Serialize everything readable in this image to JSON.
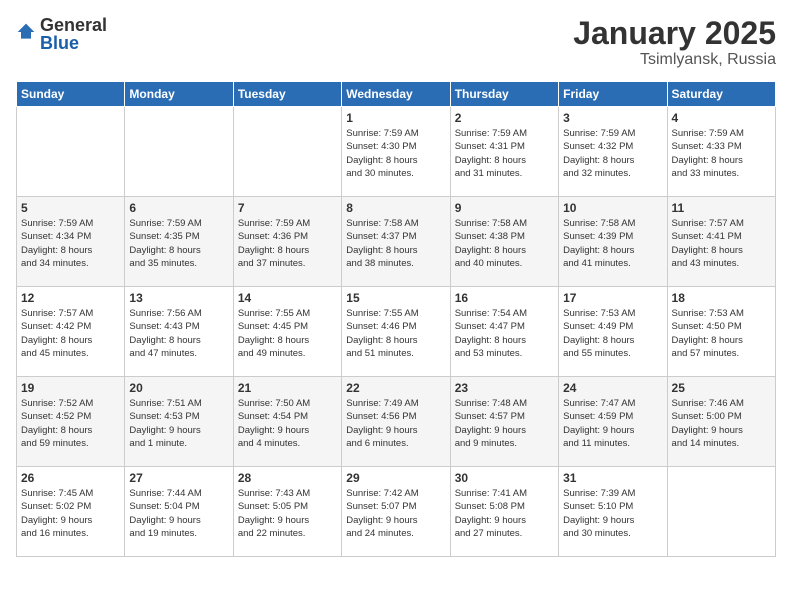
{
  "logo": {
    "text_general": "General",
    "text_blue": "Blue"
  },
  "header": {
    "month": "January 2025",
    "location": "Tsimlyansk, Russia"
  },
  "weekdays": [
    "Sunday",
    "Monday",
    "Tuesday",
    "Wednesday",
    "Thursday",
    "Friday",
    "Saturday"
  ],
  "weeks": [
    [
      {
        "day": "",
        "info": ""
      },
      {
        "day": "",
        "info": ""
      },
      {
        "day": "",
        "info": ""
      },
      {
        "day": "1",
        "info": "Sunrise: 7:59 AM\nSunset: 4:30 PM\nDaylight: 8 hours\nand 30 minutes."
      },
      {
        "day": "2",
        "info": "Sunrise: 7:59 AM\nSunset: 4:31 PM\nDaylight: 8 hours\nand 31 minutes."
      },
      {
        "day": "3",
        "info": "Sunrise: 7:59 AM\nSunset: 4:32 PM\nDaylight: 8 hours\nand 32 minutes."
      },
      {
        "day": "4",
        "info": "Sunrise: 7:59 AM\nSunset: 4:33 PM\nDaylight: 8 hours\nand 33 minutes."
      }
    ],
    [
      {
        "day": "5",
        "info": "Sunrise: 7:59 AM\nSunset: 4:34 PM\nDaylight: 8 hours\nand 34 minutes."
      },
      {
        "day": "6",
        "info": "Sunrise: 7:59 AM\nSunset: 4:35 PM\nDaylight: 8 hours\nand 35 minutes."
      },
      {
        "day": "7",
        "info": "Sunrise: 7:59 AM\nSunset: 4:36 PM\nDaylight: 8 hours\nand 37 minutes."
      },
      {
        "day": "8",
        "info": "Sunrise: 7:58 AM\nSunset: 4:37 PM\nDaylight: 8 hours\nand 38 minutes."
      },
      {
        "day": "9",
        "info": "Sunrise: 7:58 AM\nSunset: 4:38 PM\nDaylight: 8 hours\nand 40 minutes."
      },
      {
        "day": "10",
        "info": "Sunrise: 7:58 AM\nSunset: 4:39 PM\nDaylight: 8 hours\nand 41 minutes."
      },
      {
        "day": "11",
        "info": "Sunrise: 7:57 AM\nSunset: 4:41 PM\nDaylight: 8 hours\nand 43 minutes."
      }
    ],
    [
      {
        "day": "12",
        "info": "Sunrise: 7:57 AM\nSunset: 4:42 PM\nDaylight: 8 hours\nand 45 minutes."
      },
      {
        "day": "13",
        "info": "Sunrise: 7:56 AM\nSunset: 4:43 PM\nDaylight: 8 hours\nand 47 minutes."
      },
      {
        "day": "14",
        "info": "Sunrise: 7:55 AM\nSunset: 4:45 PM\nDaylight: 8 hours\nand 49 minutes."
      },
      {
        "day": "15",
        "info": "Sunrise: 7:55 AM\nSunset: 4:46 PM\nDaylight: 8 hours\nand 51 minutes."
      },
      {
        "day": "16",
        "info": "Sunrise: 7:54 AM\nSunset: 4:47 PM\nDaylight: 8 hours\nand 53 minutes."
      },
      {
        "day": "17",
        "info": "Sunrise: 7:53 AM\nSunset: 4:49 PM\nDaylight: 8 hours\nand 55 minutes."
      },
      {
        "day": "18",
        "info": "Sunrise: 7:53 AM\nSunset: 4:50 PM\nDaylight: 8 hours\nand 57 minutes."
      }
    ],
    [
      {
        "day": "19",
        "info": "Sunrise: 7:52 AM\nSunset: 4:52 PM\nDaylight: 8 hours\nand 59 minutes."
      },
      {
        "day": "20",
        "info": "Sunrise: 7:51 AM\nSunset: 4:53 PM\nDaylight: 9 hours\nand 1 minute."
      },
      {
        "day": "21",
        "info": "Sunrise: 7:50 AM\nSunset: 4:54 PM\nDaylight: 9 hours\nand 4 minutes."
      },
      {
        "day": "22",
        "info": "Sunrise: 7:49 AM\nSunset: 4:56 PM\nDaylight: 9 hours\nand 6 minutes."
      },
      {
        "day": "23",
        "info": "Sunrise: 7:48 AM\nSunset: 4:57 PM\nDaylight: 9 hours\nand 9 minutes."
      },
      {
        "day": "24",
        "info": "Sunrise: 7:47 AM\nSunset: 4:59 PM\nDaylight: 9 hours\nand 11 minutes."
      },
      {
        "day": "25",
        "info": "Sunrise: 7:46 AM\nSunset: 5:00 PM\nDaylight: 9 hours\nand 14 minutes."
      }
    ],
    [
      {
        "day": "26",
        "info": "Sunrise: 7:45 AM\nSunset: 5:02 PM\nDaylight: 9 hours\nand 16 minutes."
      },
      {
        "day": "27",
        "info": "Sunrise: 7:44 AM\nSunset: 5:04 PM\nDaylight: 9 hours\nand 19 minutes."
      },
      {
        "day": "28",
        "info": "Sunrise: 7:43 AM\nSunset: 5:05 PM\nDaylight: 9 hours\nand 22 minutes."
      },
      {
        "day": "29",
        "info": "Sunrise: 7:42 AM\nSunset: 5:07 PM\nDaylight: 9 hours\nand 24 minutes."
      },
      {
        "day": "30",
        "info": "Sunrise: 7:41 AM\nSunset: 5:08 PM\nDaylight: 9 hours\nand 27 minutes."
      },
      {
        "day": "31",
        "info": "Sunrise: 7:39 AM\nSunset: 5:10 PM\nDaylight: 9 hours\nand 30 minutes."
      },
      {
        "day": "",
        "info": ""
      }
    ]
  ]
}
